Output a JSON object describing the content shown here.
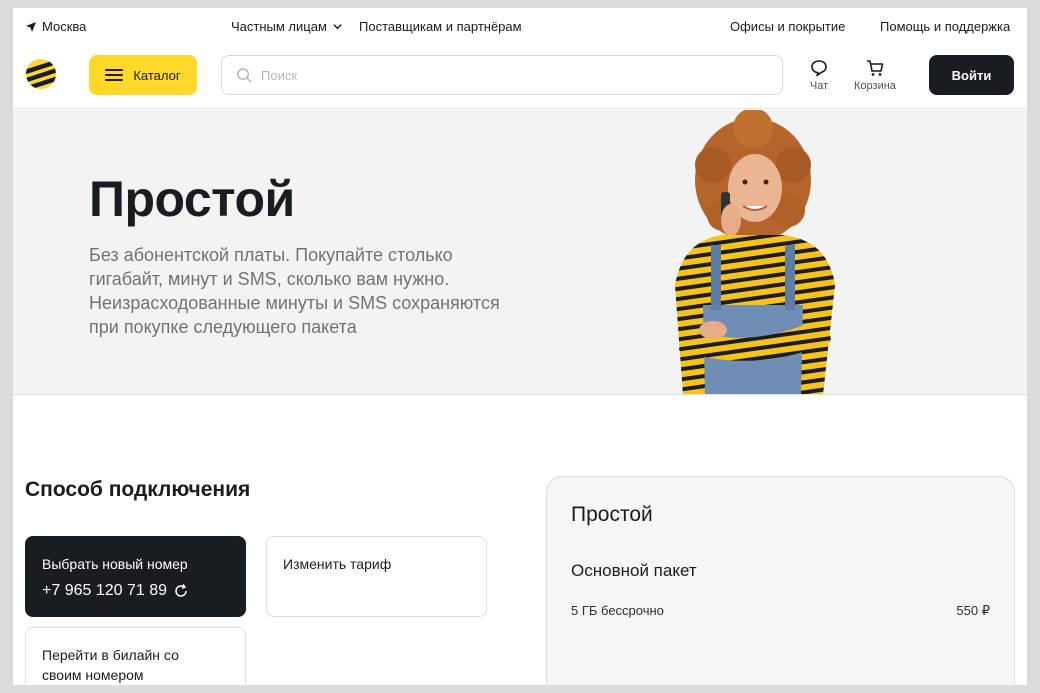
{
  "topbar": {
    "city": "Москва",
    "private_persons": "Частным лицам",
    "partners": "Поставщикам и партнёрам",
    "offices": "Офисы и покрытие",
    "help": "Помощь и поддержка"
  },
  "header": {
    "catalog_label": "Каталог",
    "search_placeholder": "Поиск",
    "chat_label": "Чат",
    "cart_label": "Корзина",
    "login_label": "Войти"
  },
  "hero": {
    "title": "Простой",
    "description": "Без абонентской платы. Покупайте столько гигабайт, минут и SMS, сколько вам нужно. Неизрасходованные минуты и SMS сохраняются при покупке следующего пакета"
  },
  "connection": {
    "title": "Способ подключения",
    "options": [
      {
        "label": "Выбрать новый номер",
        "number": "+7 965 120 71 89",
        "selected": true
      },
      {
        "label": "Изменить тариф"
      },
      {
        "label": "Перейти в билайн со своим номером"
      }
    ]
  },
  "summary": {
    "title": "Простой",
    "package_title": "Основной пакет",
    "item": "5 ГБ бессрочно",
    "price": "550 ₽"
  },
  "colors": {
    "brand_yellow": "#ffd829",
    "dark": "#191c21",
    "hero_bg": "#f3f3f3"
  },
  "icons": [
    "location-arrow-icon",
    "chevron-down-icon",
    "beeline-logo",
    "menu-icon",
    "search-icon",
    "chat-icon",
    "cart-icon",
    "refresh-icon"
  ]
}
